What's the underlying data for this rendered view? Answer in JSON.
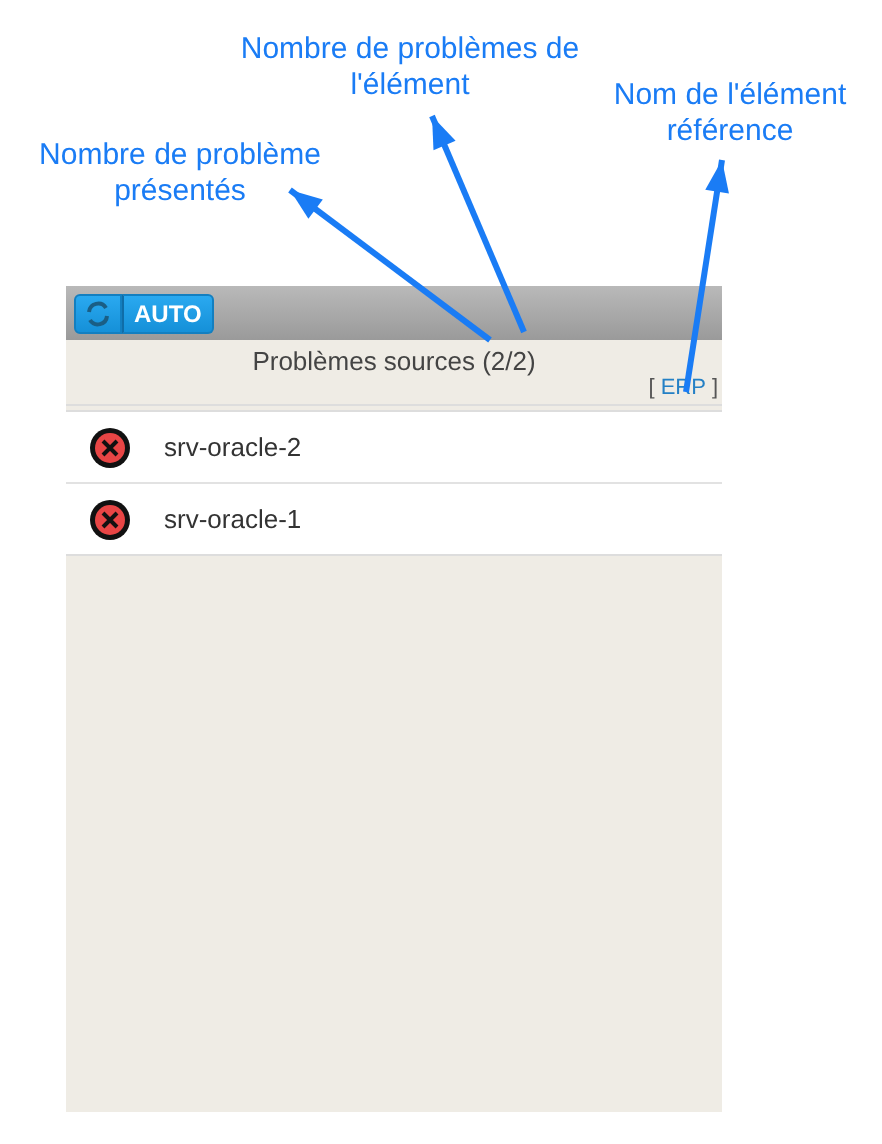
{
  "toolbar": {
    "auto_button": "AUTO"
  },
  "header": {
    "title": "Problèmes sources (2/2)",
    "reference": {
      "left": "[",
      "name": "ERP",
      "right": "]"
    }
  },
  "items": [
    {
      "name": "srv-oracle-2",
      "kind": "error"
    },
    {
      "name": "srv-oracle-1",
      "kind": "error"
    }
  ],
  "annotations": [
    {
      "text": "Nombre de problème présentés"
    },
    {
      "text": "Nombre de problèmes de l'élément"
    },
    {
      "text": "Nom de l'élément référence"
    }
  ]
}
